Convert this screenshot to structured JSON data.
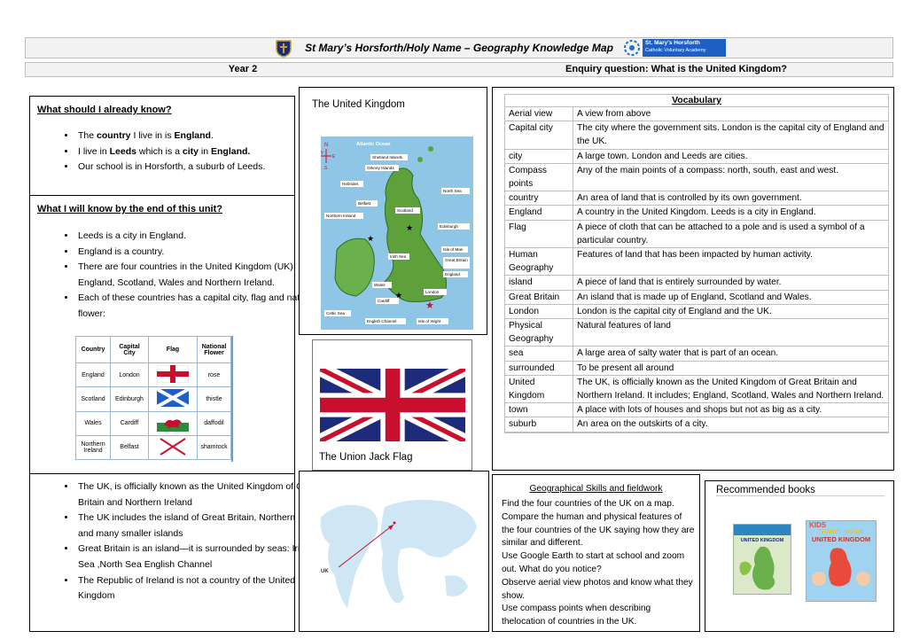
{
  "header": {
    "title": "St Mary’s Horsforth/Holy Name – Geography Knowledge Map",
    "year": "Year 2",
    "enquiry": "Enquiry question: What is the United Kingdom?",
    "logo_text_1": "St. Mary's Horsforth",
    "logo_text_2": "Catholic Voluntary Academy"
  },
  "know_already": {
    "heading": "What should I already know?",
    "items": [
      {
        "pre": "The ",
        "b1": "country",
        "mid": " I live in is ",
        "b2": "England",
        "post": "."
      },
      {
        "pre": "I live in ",
        "b1": "Leeds",
        "mid": " which is a ",
        "b2": "city",
        "post": " in ",
        "b3": "England."
      },
      {
        "pre": "Our school is in Horsforth, a suburb of Leeds."
      }
    ]
  },
  "know_end": {
    "heading": "What I will know by the end of this unit?",
    "items": [
      "Leeds is a city in England.",
      "England is a country.",
      "There are four countries in the United Kingdom (UK):  England, Scotland, Wales and Northern Ireland.",
      "Each of these countries has a capital city, flag and national flower:"
    ],
    "items2": [
      "The UK, is officially known as the United Kingdom of Great Britain and Northern Ireland",
      " The UK includes the island of Great Britain, Northern Ireland and many smaller islands",
      "Great Britain is an island—it is surrounded by seas: Irish Sea ,North Sea English Channel",
      "The Republic of Ireland is not a country of the United Kingdom"
    ]
  },
  "capitals_table": {
    "headers": [
      "Country",
      "Capital City",
      "Flag",
      "National Flower"
    ],
    "rows": [
      {
        "country": "England",
        "capital": "London",
        "flower": "rose"
      },
      {
        "country": "Scotland",
        "capital": "Edinburgh",
        "flower": "thistle"
      },
      {
        "country": "Wales",
        "capital": "Cardiff",
        "flower": "daffodil"
      },
      {
        "country": "Northern Ireland",
        "capital": "Belfast",
        "flower": "shamrock"
      }
    ]
  },
  "uk_map": {
    "heading": "The United Kingdom",
    "labels": {
      "compass_n": "N",
      "compass_e": "E",
      "compass_w": "W",
      "compass_s": "S",
      "atlantic": "Atlantic Ocean",
      "shetland": "Shetland Islands",
      "orkney": "Orkney Islands",
      "hebrides": "Hebrides",
      "north_sea": "North Sea",
      "belfast": "Belfast",
      "scotland": "Scotland",
      "northern_ireland": "Northern Ireland",
      "edinburgh": "Edinburgh",
      "isle_of_man": "Isle of Man",
      "irish_sea": "Irish Sea",
      "great_britain": "Great Britain",
      "england": "England",
      "wales": "Wales",
      "london": "London",
      "cardiff": "Cardiff",
      "celtic_sea": "Celtic Sea",
      "english_channel": "English Channel",
      "isle_of_wight": "Isle of Wight"
    }
  },
  "flag": {
    "caption": "The  Union Jack Flag"
  },
  "world_map": {
    "label": "UK"
  },
  "vocabulary": {
    "heading": "Vocabulary",
    "rows": [
      {
        "term": "Aerial view",
        "def": "A view from above"
      },
      {
        "term": "Capital city",
        "def": "The city where the government sits. London is the capital city of England and the UK."
      },
      {
        "term": "city",
        "def": "A large town. London and Leeds are cities."
      },
      {
        "term": "Compass points",
        "def": "Any of the main points of a compass: north, south, east and west."
      },
      {
        "term": "country",
        "def": "An area of land that is controlled by its own government."
      },
      {
        "term": "England",
        "def": "A country in the United Kingdom. Leeds is a city in England."
      },
      {
        "term": "Flag",
        "def": "A piece of cloth that can be attached to a pole and is used a symbol of a particular country."
      },
      {
        "term": "Human Geography",
        "def": "Features of land that has been impacted by human activity."
      },
      {
        "term": "island",
        "def": "A piece of land that is entirely surrounded by water."
      },
      {
        "term": "Great Britain",
        "def": "An island that is made up of England, Scotland and Wales."
      },
      {
        "term": "London",
        "def": "London is the capital city of England and the UK."
      },
      {
        "term": "Physical Geography",
        "def": "Natural features of land"
      },
      {
        "term": "sea",
        "def": "A large area of salty water that is part of an ocean."
      },
      {
        "term": "surrounded",
        "def": "To be present all around"
      },
      {
        "term": "United Kingdom",
        "def": "The UK, is officially known as the United Kingdom of Great Britain and Northern Ireland. It includes; England, Scotland, Wales and Northern Ireland."
      },
      {
        "term": "town",
        "def": "A place with lots of houses and shops but not as big as a city."
      },
      {
        "term": "suburb",
        "def": "An area on the outskirts of a city."
      }
    ]
  },
  "skills": {
    "heading": "Geographical Skills and fieldwork",
    "lines": [
      "Find the four countries of the UK on a map.",
      "Compare the human and physical features of the four countries of the UK saying how they are similar and different.",
      "Use Google Earth to start at school and zoom out. What do you notice?",
      "Observe aerial view photos and know what they show.",
      "Use compass points when describing thelocation of countries in the UK."
    ]
  },
  "books": {
    "heading": "Recommended books",
    "book1_title": "UNITED KINGDOM",
    "book2_title_1": "TRAVEL GUIDE",
    "book2_title_2": "UNITED KINGDOM",
    "book2_kids": "KIDS"
  },
  "colors": {
    "header_bg": "#f2f2f2",
    "sea": "#8fc6e6",
    "land_green": "#5ea13a",
    "flag_blue": "#1d2b7a",
    "flag_red": "#c8102e"
  }
}
